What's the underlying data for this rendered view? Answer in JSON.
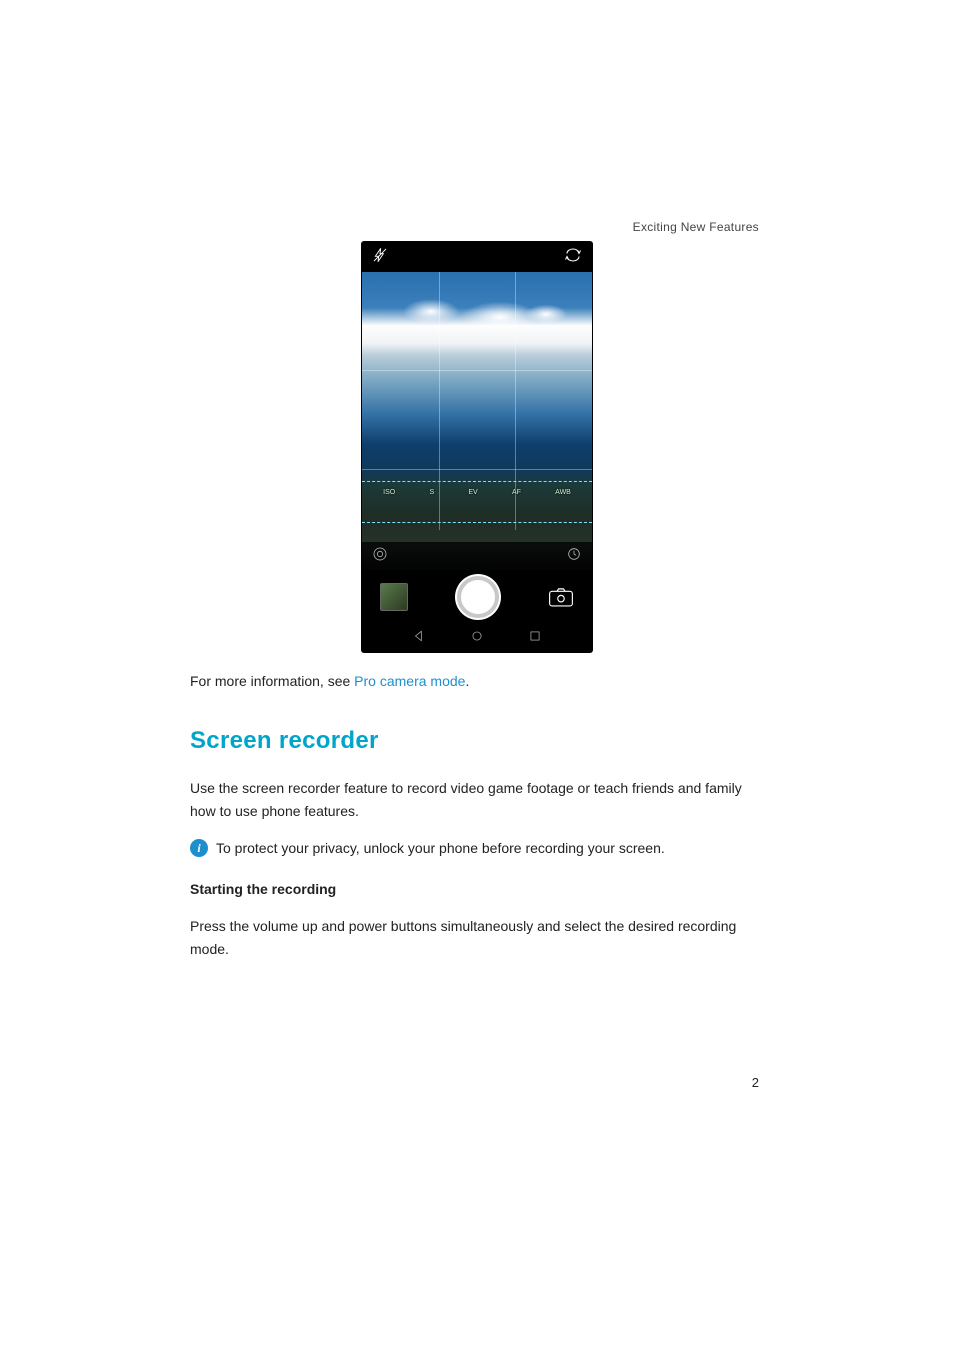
{
  "running_header": "Exciting New Features",
  "page_number": "2",
  "camera": {
    "pro_params": {
      "iso": "ISO",
      "s": "S",
      "ev": "EV",
      "af": "AF",
      "awb": "AWB"
    }
  },
  "intro_sentence_prefix": "For more information, see ",
  "intro_link_text": "Pro camera mode",
  "intro_sentence_suffix": ".",
  "section_heading": "Screen recorder",
  "section_body": "Use the screen recorder feature to record video game footage or teach friends and family how to use phone features.",
  "callout_text": "To protect your privacy, unlock your phone before recording your screen.",
  "subheading": "Starting the recording",
  "subbody": "Press the volume up and power buttons simultaneously and select the desired recording mode."
}
